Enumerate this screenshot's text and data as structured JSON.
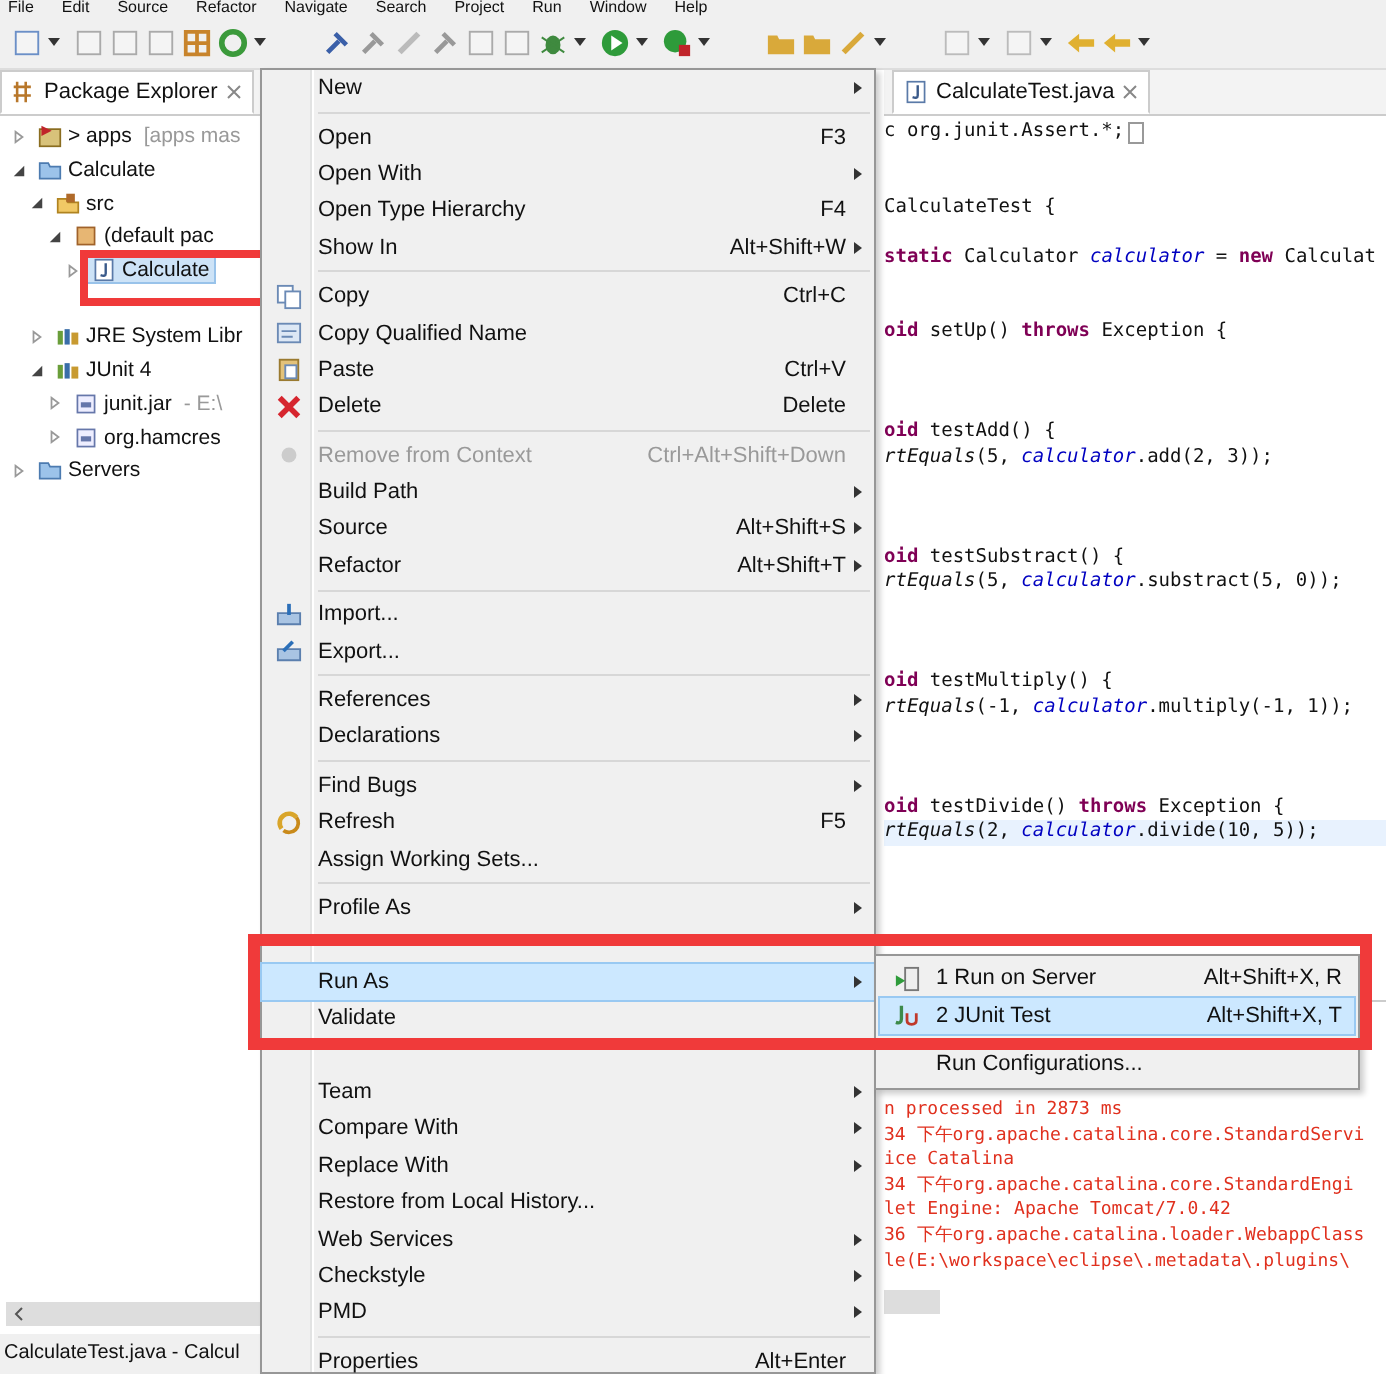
{
  "menu_bar": [
    "File",
    "Edit",
    "Source",
    "Refactor",
    "Navigate",
    "Search",
    "Project",
    "Run",
    "Window",
    "Help"
  ],
  "package_explorer": {
    "tab": {
      "label": "Package Explorer",
      "selected": true
    },
    "tree": [
      {
        "label": "> apps",
        "detail": "[apps mas",
        "kind": "git-project",
        "expanded": false,
        "selected": false
      },
      {
        "label": "Calculate",
        "kind": "project",
        "expanded": true,
        "selected": false,
        "children": [
          {
            "label": "src",
            "kind": "source-folder",
            "expanded": true,
            "selected": false,
            "children": [
              {
                "label": "(default pac",
                "kind": "package",
                "expanded": true,
                "selected": false,
                "children": [
                  {
                    "label": "Calculate",
                    "kind": "java-file",
                    "expanded": false,
                    "selected": true
                  },
                  {
                    "kind": "covered"
                  }
                ]
              }
            ]
          },
          {
            "label": "JRE System Libr",
            "kind": "library",
            "expanded": false,
            "selected": false
          },
          {
            "label": "JUnit 4",
            "kind": "library",
            "expanded": true,
            "selected": false,
            "children": [
              {
                "label": "junit.jar",
                "detail": "- E:\\",
                "kind": "jar",
                "expanded": false,
                "selected": false
              },
              {
                "label": "org.hamcres",
                "kind": "jar",
                "expanded": false,
                "selected": false
              }
            ]
          }
        ]
      },
      {
        "label": "Servers",
        "kind": "folder",
        "expanded": false,
        "selected": false
      }
    ]
  },
  "editor": {
    "tab": {
      "label": "CalculateTest.java",
      "selected": true
    },
    "lines": [
      {
        "kind": "code",
        "tokens": [
          {
            "text": "c org.junit.Assert.*;",
            "kind": "plain"
          }
        ],
        "folded": true
      },
      {
        "kind": "blank"
      },
      {
        "kind": "blank"
      },
      {
        "kind": "code",
        "tokens": [
          {
            "text": " CalculateTest {",
            "kind": "plain"
          }
        ]
      },
      {
        "kind": "blank"
      },
      {
        "kind": "code",
        "tokens": [
          {
            "text": "static",
            "kind": "keyword"
          },
          {
            "text": " Calculator ",
            "kind": "plain"
          },
          {
            "text": "calculator",
            "kind": "field"
          },
          {
            "text": " = ",
            "kind": "plain"
          },
          {
            "text": "new",
            "kind": "keyword"
          },
          {
            "text": " Calculat",
            "kind": "plain"
          }
        ]
      },
      {
        "kind": "blank"
      },
      {
        "kind": "blank"
      },
      {
        "kind": "code",
        "tokens": [
          {
            "text": "oid",
            "kind": "keyword"
          },
          {
            "text": " setUp() ",
            "kind": "plain"
          },
          {
            "text": "throws",
            "kind": "keyword"
          },
          {
            "text": " Exception {",
            "kind": "plain"
          }
        ]
      },
      {
        "kind": "blank"
      },
      {
        "kind": "blank"
      },
      {
        "kind": "blank"
      },
      {
        "kind": "code",
        "tokens": [
          {
            "text": "oid",
            "kind": "keyword"
          },
          {
            "text": " testAdd() {",
            "kind": "plain"
          }
        ]
      },
      {
        "kind": "code",
        "tokens": [
          {
            "text": "rtEquals",
            "kind": "static"
          },
          {
            "text": "(5, ",
            "kind": "plain"
          },
          {
            "text": "calculator",
            "kind": "field"
          },
          {
            "text": ".add(2, 3));",
            "kind": "plain"
          }
        ]
      },
      {
        "kind": "blank"
      },
      {
        "kind": "blank"
      },
      {
        "kind": "blank"
      },
      {
        "kind": "code",
        "tokens": [
          {
            "text": "oid",
            "kind": "keyword"
          },
          {
            "text": " testSubstract() {",
            "kind": "plain"
          }
        ]
      },
      {
        "kind": "code",
        "tokens": [
          {
            "text": "rtEquals",
            "kind": "static"
          },
          {
            "text": "(5, ",
            "kind": "plain"
          },
          {
            "text": "calculator",
            "kind": "field"
          },
          {
            "text": ".substract(5, 0));",
            "kind": "plain"
          }
        ]
      },
      {
        "kind": "blank"
      },
      {
        "kind": "blank"
      },
      {
        "kind": "blank"
      },
      {
        "kind": "code",
        "tokens": [
          {
            "text": "oid",
            "kind": "keyword"
          },
          {
            "text": " testMultiply() {",
            "kind": "plain"
          }
        ]
      },
      {
        "kind": "code",
        "tokens": [
          {
            "text": "rtEquals",
            "kind": "static"
          },
          {
            "text": "(-1, ",
            "kind": "plain"
          },
          {
            "text": "calculator",
            "kind": "field"
          },
          {
            "text": ".multiply(-1, 1));",
            "kind": "plain"
          }
        ]
      },
      {
        "kind": "blank"
      },
      {
        "kind": "blank"
      },
      {
        "kind": "blank"
      },
      {
        "kind": "code",
        "tokens": [
          {
            "text": "oid",
            "kind": "keyword"
          },
          {
            "text": " testDivide() ",
            "kind": "plain"
          },
          {
            "text": "throws",
            "kind": "keyword"
          },
          {
            "text": " Exception {",
            "kind": "plain"
          }
        ]
      },
      {
        "kind": "code",
        "tokens": [
          {
            "text": "rtEquals",
            "kind": "static"
          },
          {
            "text": "(2, ",
            "kind": "plain"
          },
          {
            "text": "calculator",
            "kind": "field"
          },
          {
            "text": ".divide(10, 5));",
            "kind": "plain"
          }
        ],
        "current": true
      }
    ]
  },
  "console": {
    "lines": [
      "n processed in 2873 ms",
      "34 下午org.apache.catalina.core.StandardServi",
      "ice Catalina",
      "34 下午org.apache.catalina.core.StandardEngi",
      "let Engine: Apache Tomcat/7.0.42",
      "36 下午org.apache.catalina.loader.WebappClass",
      "le(E:\\workspace\\eclipse\\.metadata\\.plugins\\"
    ]
  },
  "context_menu": {
    "groups": [
      [
        {
          "label": "New",
          "submenu": true,
          "selected": false,
          "disabled": false
        }
      ],
      [
        {
          "label": "Open",
          "shortcut": "F3",
          "selected": false,
          "disabled": false
        },
        {
          "label": "Open With",
          "submenu": true,
          "selected": false,
          "disabled": false
        },
        {
          "label": "Open Type Hierarchy",
          "shortcut": "F4",
          "selected": false,
          "disabled": false
        },
        {
          "label": "Show In",
          "shortcut": "Alt+Shift+W",
          "submenu": true,
          "selected": false,
          "disabled": false
        }
      ],
      [
        {
          "label": "Copy",
          "shortcut": "Ctrl+C",
          "kind": "copy",
          "selected": false,
          "disabled": false
        },
        {
          "label": "Copy Qualified Name",
          "kind": "copy-name",
          "selected": false,
          "disabled": false
        },
        {
          "label": "Paste",
          "shortcut": "Ctrl+V",
          "kind": "paste",
          "selected": false,
          "disabled": false
        },
        {
          "label": "Delete",
          "shortcut": "Delete",
          "kind": "delete",
          "selected": false,
          "disabled": false
        }
      ],
      [
        {
          "label": "Remove from Context",
          "shortcut": "Ctrl+Alt+Shift+Down",
          "kind": "remove",
          "selected": false,
          "disabled": true
        },
        {
          "label": "Build Path",
          "submenu": true,
          "selected": false,
          "disabled": false
        },
        {
          "label": "Source",
          "shortcut": "Alt+Shift+S",
          "submenu": true,
          "selected": false,
          "disabled": false
        },
        {
          "label": "Refactor",
          "shortcut": "Alt+Shift+T",
          "submenu": true,
          "selected": false,
          "disabled": false
        }
      ],
      [
        {
          "label": "Import...",
          "kind": "import",
          "selected": false,
          "disabled": false
        },
        {
          "label": "Export...",
          "kind": "export",
          "selected": false,
          "disabled": false
        }
      ],
      [
        {
          "label": "References",
          "submenu": true,
          "selected": false,
          "disabled": false
        },
        {
          "label": "Declarations",
          "submenu": true,
          "selected": false,
          "disabled": false
        }
      ],
      [
        {
          "label": "Find Bugs",
          "submenu": true,
          "selected": false,
          "disabled": false
        },
        {
          "label": "Refresh",
          "shortcut": "F5",
          "kind": "refresh",
          "selected": false,
          "disabled": false
        },
        {
          "label": "Assign Working Sets...",
          "selected": false,
          "disabled": false
        }
      ],
      [
        {
          "label": "Profile As",
          "submenu": true,
          "selected": false,
          "disabled": false
        },
        {
          "kind": "covered"
        },
        {
          "label": "Run As",
          "submenu": true,
          "selected": true,
          "disabled": false
        },
        {
          "label": "Validate",
          "selected": false,
          "disabled": false
        },
        {
          "kind": "covered"
        },
        {
          "label": "Team",
          "submenu": true,
          "selected": false,
          "disabled": false
        },
        {
          "label": "Compare With",
          "submenu": true,
          "selected": false,
          "disabled": false
        },
        {
          "label": "Replace With",
          "submenu": true,
          "selected": false,
          "disabled": false
        },
        {
          "label": "Restore from Local History...",
          "selected": false,
          "disabled": false
        },
        {
          "label": "Web Services",
          "submenu": true,
          "selected": false,
          "disabled": false
        },
        {
          "label": "Checkstyle",
          "submenu": true,
          "selected": false,
          "disabled": false
        },
        {
          "label": "PMD",
          "submenu": true,
          "selected": false,
          "disabled": false
        }
      ],
      [
        {
          "label": "Properties",
          "shortcut": "Alt+Enter",
          "selected": false,
          "disabled": false
        }
      ]
    ]
  },
  "run_as_submenu": {
    "groups": [
      [
        {
          "label": "1 Run on Server",
          "shortcut": "Alt+Shift+X, R",
          "kind": "server",
          "selected": false
        },
        {
          "label": "2 JUnit Test",
          "shortcut": "Alt+Shift+X, T",
          "kind": "junit",
          "selected": true
        }
      ],
      [
        {
          "label": "Run Configurations...",
          "selected": false
        }
      ]
    ]
  },
  "status_bar": {
    "text": "CalculateTest.java - Calcul"
  }
}
